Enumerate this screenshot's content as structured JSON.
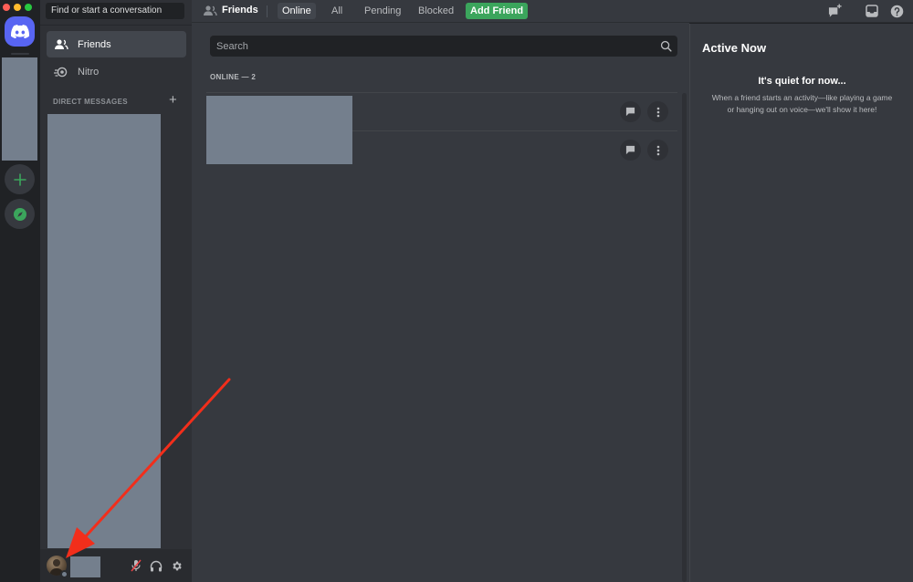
{
  "colors": {
    "brand": "#5865f2",
    "add_friend_green": "#3ba55c",
    "annotation_arrow": "#f22e1b",
    "traffic_close": "#ff5f57",
    "traffic_min": "#febc2e",
    "traffic_max": "#28c840",
    "rail_icon_green": "#3ba55c"
  },
  "server_rail": {
    "home_icon": "discord-logo-icon",
    "add_server_icon": "plus-icon",
    "explore_icon": "compass-icon"
  },
  "dm_sidebar": {
    "search_placeholder": "Find or start a conversation",
    "items": [
      {
        "label": "Friends",
        "icon": "friends-icon"
      },
      {
        "label": "Nitro",
        "icon": "nitro-icon"
      }
    ],
    "direct_messages_header": "DIRECT MESSAGES",
    "add_dm": "+"
  },
  "user_bar": {
    "mute_icon": "microphone-muted-icon",
    "deafen_icon": "headphones-icon",
    "settings_icon": "gear-icon"
  },
  "top_bar": {
    "title": "Friends",
    "tabs": [
      "Online",
      "All",
      "Pending",
      "Blocked"
    ],
    "active_tab": "Online",
    "add_friend": "Add Friend"
  },
  "main": {
    "search_placeholder": "Search",
    "online_header": "ONLINE — 2",
    "friends": [
      {
        "message_icon": "chat-bubble-icon",
        "more_icon": "more-vertical-icon"
      },
      {
        "message_icon": "chat-bubble-icon",
        "more_icon": "more-vertical-icon"
      }
    ]
  },
  "active_now": {
    "title": "Active Now",
    "empty_title": "It's quiet for now...",
    "empty_desc": "When a friend starts an activity—like playing a game or hanging out on voice—we'll show it here!"
  }
}
